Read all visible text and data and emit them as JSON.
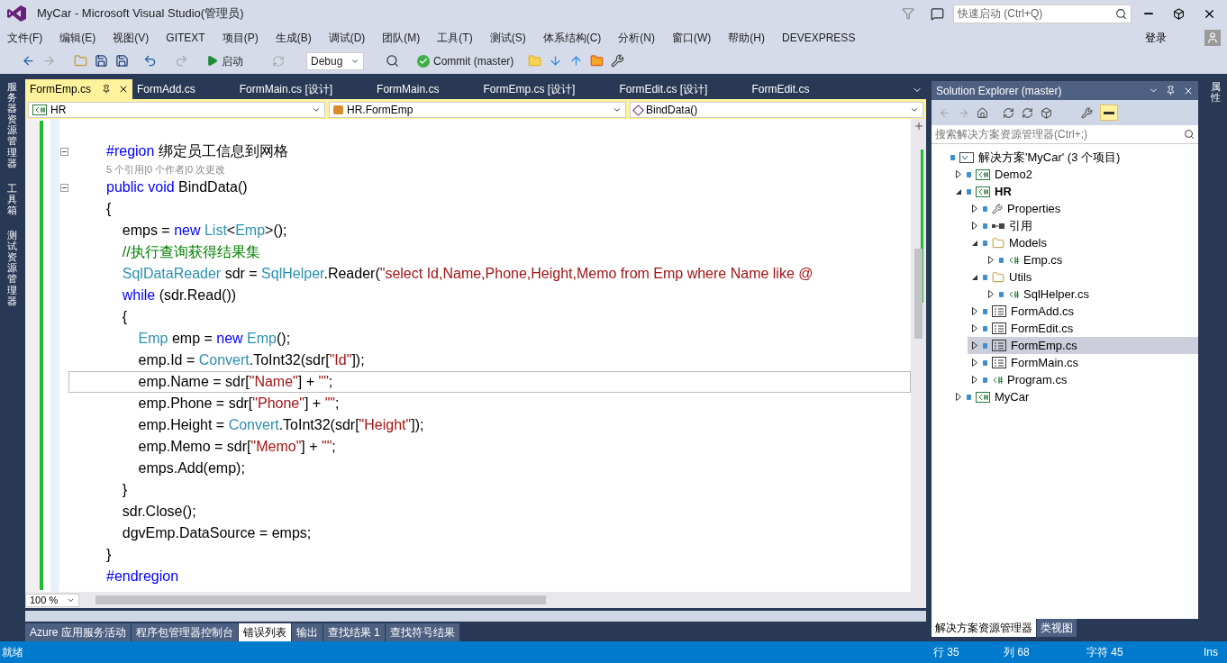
{
  "window": {
    "title": "MyCar - Microsoft Visual Studio(管理员)",
    "quick_launch": {
      "placeholder": "快速启动 (Ctrl+Q)"
    },
    "sign_in": "登录"
  },
  "menu": [
    "文件(F)",
    "编辑(E)",
    "视图(V)",
    "GITEXT",
    "项目(P)",
    "生成(B)",
    "调试(D)",
    "团队(M)",
    "工具(T)",
    "测试(S)",
    "体系结构(C)",
    "分析(N)",
    "窗口(W)",
    "帮助(H)",
    "DEVEXPRESS"
  ],
  "toolbar": {
    "start": "启动",
    "configuration": "Debug",
    "commit": "Commit (master)"
  },
  "left_dock": [
    "服务器资源管理器",
    "工具箱",
    "测试资源管理器"
  ],
  "right_dock": [
    "属性"
  ],
  "editor": {
    "tabs": [
      {
        "label": "FormEmp.cs",
        "selected": true
      },
      {
        "label": "FormAdd.cs",
        "selected": false
      },
      {
        "label": "FormMain.cs [设计]",
        "selected": false
      },
      {
        "label": "FormMain.cs",
        "selected": false
      },
      {
        "label": "FormEmp.cs [设计]",
        "selected": false
      },
      {
        "label": "FormEdit.cs [设计]",
        "selected": false
      },
      {
        "label": "FormEdit.cs",
        "selected": false
      }
    ],
    "nav": [
      {
        "kind": "project",
        "label": "HR"
      },
      {
        "kind": "class",
        "label": "HR.FormEmp"
      },
      {
        "kind": "method",
        "label": "BindData()"
      }
    ],
    "lines": [
      {
        "kind": "code",
        "foldable": true,
        "current": false,
        "tokens": [
          {
            "kind": "keyword",
            "text": "#region"
          },
          {
            "kind": "plain",
            "text": " 绑定员工信息到网格"
          }
        ]
      },
      {
        "kind": "lens",
        "current": false,
        "text": "5 个引用|0 个作者|0 次更改"
      },
      {
        "kind": "code",
        "foldable": true,
        "current": false,
        "tokens": [
          {
            "kind": "keyword",
            "text": "public void"
          },
          {
            "kind": "plain",
            "text": " BindData()"
          }
        ]
      },
      {
        "kind": "code",
        "foldable": false,
        "current": false,
        "tokens": [
          {
            "kind": "plain",
            "text": "{"
          }
        ]
      },
      {
        "kind": "code",
        "foldable": false,
        "current": false,
        "tokens": [
          {
            "kind": "plain",
            "text": "    emps = "
          },
          {
            "kind": "keyword",
            "text": "new"
          },
          {
            "kind": "type",
            "text": " List"
          },
          {
            "kind": "plain",
            "text": "<"
          },
          {
            "kind": "type",
            "text": "Emp"
          },
          {
            "kind": "plain",
            "text": ">();"
          }
        ]
      },
      {
        "kind": "code",
        "foldable": false,
        "current": false,
        "tokens": [
          {
            "kind": "comment",
            "text": "    //执行查询获得结果集"
          }
        ]
      },
      {
        "kind": "code",
        "foldable": false,
        "current": false,
        "tokens": [
          {
            "kind": "type",
            "text": "    SqlDataReader"
          },
          {
            "kind": "plain",
            "text": " sdr = "
          },
          {
            "kind": "type",
            "text": "SqlHelper"
          },
          {
            "kind": "plain",
            "text": ".Reader("
          },
          {
            "kind": "string",
            "text": "\"select Id,Name,Phone,Height,Memo from Emp where Name like @"
          }
        ]
      },
      {
        "kind": "code",
        "foldable": false,
        "current": false,
        "tokens": [
          {
            "kind": "keyword",
            "text": "    while"
          },
          {
            "kind": "plain",
            "text": " (sdr.Read())"
          }
        ]
      },
      {
        "kind": "code",
        "foldable": false,
        "current": false,
        "tokens": [
          {
            "kind": "plain",
            "text": "    {"
          }
        ]
      },
      {
        "kind": "code",
        "foldable": false,
        "current": false,
        "tokens": [
          {
            "kind": "type",
            "text": "        Emp"
          },
          {
            "kind": "plain",
            "text": " emp = "
          },
          {
            "kind": "keyword",
            "text": "new"
          },
          {
            "kind": "type",
            "text": " Emp"
          },
          {
            "kind": "plain",
            "text": "();"
          }
        ]
      },
      {
        "kind": "code",
        "foldable": false,
        "current": false,
        "tokens": [
          {
            "kind": "plain",
            "text": "        emp.Id = "
          },
          {
            "kind": "type",
            "text": "Convert"
          },
          {
            "kind": "plain",
            "text": ".ToInt32(sdr["
          },
          {
            "kind": "string",
            "text": "\"Id\""
          },
          {
            "kind": "plain",
            "text": "]);"
          }
        ]
      },
      {
        "kind": "code",
        "foldable": false,
        "current": true,
        "tokens": [
          {
            "kind": "plain",
            "text": "        emp.Name = sdr["
          },
          {
            "kind": "string",
            "text": "\"Name\""
          },
          {
            "kind": "plain",
            "text": "] + "
          },
          {
            "kind": "string",
            "text": "\"\""
          },
          {
            "kind": "plain",
            "text": ";"
          }
        ]
      },
      {
        "kind": "code",
        "foldable": false,
        "current": false,
        "tokens": [
          {
            "kind": "plain",
            "text": "        emp.Phone = sdr["
          },
          {
            "kind": "string",
            "text": "\"Phone\""
          },
          {
            "kind": "plain",
            "text": "] + "
          },
          {
            "kind": "string",
            "text": "\"\""
          },
          {
            "kind": "plain",
            "text": ";"
          }
        ]
      },
      {
        "kind": "code",
        "foldable": false,
        "current": false,
        "tokens": [
          {
            "kind": "plain",
            "text": "        emp.Height = "
          },
          {
            "kind": "type",
            "text": "Convert"
          },
          {
            "kind": "plain",
            "text": ".ToInt32(sdr["
          },
          {
            "kind": "string",
            "text": "\"Height\""
          },
          {
            "kind": "plain",
            "text": "]);"
          }
        ]
      },
      {
        "kind": "code",
        "foldable": false,
        "current": false,
        "tokens": [
          {
            "kind": "plain",
            "text": "        emp.Memo = sdr["
          },
          {
            "kind": "string",
            "text": "\"Memo\""
          },
          {
            "kind": "plain",
            "text": "] + "
          },
          {
            "kind": "string",
            "text": "\"\""
          },
          {
            "kind": "plain",
            "text": ";"
          }
        ]
      },
      {
        "kind": "code",
        "foldable": false,
        "current": false,
        "tokens": [
          {
            "kind": "plain",
            "text": "        emps.Add(emp);"
          }
        ]
      },
      {
        "kind": "code",
        "foldable": false,
        "current": false,
        "tokens": [
          {
            "kind": "plain",
            "text": "    }"
          }
        ]
      },
      {
        "kind": "code",
        "foldable": false,
        "current": false,
        "tokens": [
          {
            "kind": "plain",
            "text": "    sdr.Close();"
          }
        ]
      },
      {
        "kind": "code",
        "foldable": false,
        "current": false,
        "tokens": [
          {
            "kind": "plain",
            "text": "    dgvEmp.DataSource = emps;"
          }
        ]
      },
      {
        "kind": "code",
        "foldable": false,
        "current": false,
        "tokens": [
          {
            "kind": "plain",
            "text": "}"
          }
        ]
      },
      {
        "kind": "code",
        "foldable": false,
        "current": false,
        "tokens": [
          {
            "kind": "keyword",
            "text": "#endregion"
          }
        ]
      }
    ],
    "zoom": "100 %"
  },
  "bottom_tabs": [
    {
      "label": "Azure 应用服务活动",
      "selected": false
    },
    {
      "label": "程序包管理器控制台",
      "selected": false
    },
    {
      "label": "错误列表",
      "selected": true
    },
    {
      "label": "输出",
      "selected": false
    },
    {
      "label": "查找结果 1",
      "selected": false
    },
    {
      "label": "查找符号结果",
      "selected": false
    }
  ],
  "solution_explorer": {
    "title": "Solution Explorer (master)",
    "search": {
      "placeholder": "搜索解决方案资源管理器(Ctrl+;)"
    },
    "tree": [
      {
        "kind": "solution",
        "label": "解决方案'MyCar' (3 个项目)",
        "selected": false,
        "children": [
          {
            "kind": "project",
            "label": "Demo2",
            "startup": false,
            "expanded": false,
            "selected": false
          },
          {
            "kind": "project",
            "label": "HR",
            "startup": true,
            "expanded": true,
            "selected": false,
            "children": [
              {
                "kind": "properties",
                "label": "Properties",
                "expanded": false,
                "selected": false
              },
              {
                "kind": "references",
                "label": "引用",
                "expanded": false,
                "selected": false
              },
              {
                "kind": "folder",
                "label": "Models",
                "expanded": true,
                "selected": false,
                "children": [
                  {
                    "kind": "csfile",
                    "label": "Emp.cs",
                    "expanded": false,
                    "selected": false
                  }
                ]
              },
              {
                "kind": "folder",
                "label": "Utils",
                "expanded": true,
                "selected": false,
                "children": [
                  {
                    "kind": "csfile",
                    "label": "SqlHelper.cs",
                    "expanded": false,
                    "selected": false
                  }
                ]
              },
              {
                "kind": "form",
                "label": "FormAdd.cs",
                "expanded": false,
                "selected": false
              },
              {
                "kind": "form",
                "label": "FormEdit.cs",
                "expanded": false,
                "selected": false
              },
              {
                "kind": "form",
                "label": "FormEmp.cs",
                "expanded": false,
                "selected": true
              },
              {
                "kind": "form",
                "label": "FormMain.cs",
                "expanded": false,
                "selected": false
              },
              {
                "kind": "csfile",
                "label": "Program.cs",
                "expanded": false,
                "selected": false
              }
            ]
          },
          {
            "kind": "project",
            "label": "MyCar",
            "startup": false,
            "expanded": false,
            "selected": false
          }
        ]
      }
    ],
    "tabs": [
      {
        "label": "解决方案资源管理器",
        "selected": true
      },
      {
        "label": "类视图",
        "selected": false
      }
    ]
  },
  "status_bar": {
    "message": "就绪",
    "line": "行 35",
    "column": "列 68",
    "char": "字符 45",
    "mode": "Ins"
  }
}
